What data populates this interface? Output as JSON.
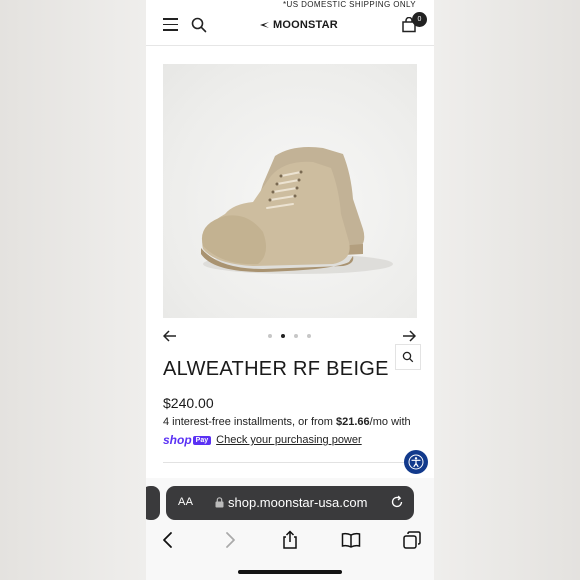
{
  "banner": {
    "text": "*US DOMESTIC SHIPPING ONLY"
  },
  "header": {
    "logo_text": "MOONSTAR",
    "cart_count": "0"
  },
  "product": {
    "title": "ALWEATHER RF BEIGE",
    "price": "$240.00",
    "installments_prefix": "4 interest-free installments, or from ",
    "installments_amount": "$21.66",
    "installments_suffix": "/mo with",
    "shoppay_shop": "shop",
    "shoppay_pay": "Pay",
    "shoppay_link": "Check your purchasing power",
    "image_icon": "boot-photo",
    "gallery": {
      "count": 4,
      "active_index": 1
    }
  },
  "browser": {
    "aa_label": "AA",
    "url": "shop.moonstar-usa.com"
  },
  "colors": {
    "brand_purple": "#5a31f4",
    "accessibility_blue": "#123a8c",
    "boot_color": "#c9b9a0"
  }
}
